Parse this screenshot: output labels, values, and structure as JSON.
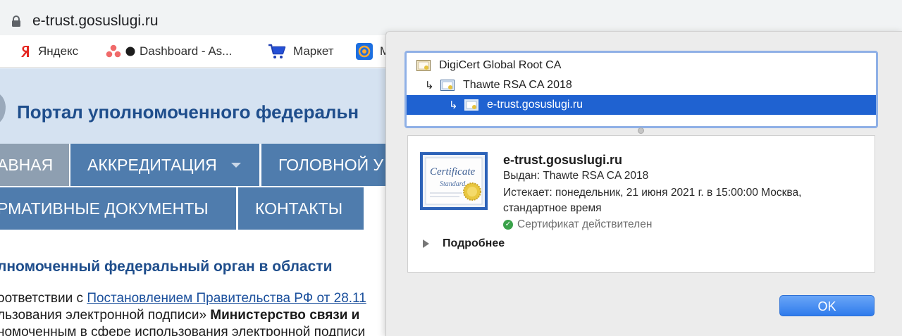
{
  "browser": {
    "url": "e-trust.gosuslugi.ru",
    "bookmarks": [
      {
        "label": "Яндекс",
        "icon": "yandex-icon"
      },
      {
        "label": "Dashboard - As...",
        "icon": "asana-icon"
      },
      {
        "label": "Маркет",
        "icon": "cart-icon"
      },
      {
        "label": "M",
        "icon": "mail-icon"
      }
    ]
  },
  "site": {
    "header_title": "Портал уполномоченного федеральн",
    "header_title_right": "н",
    "nav": [
      {
        "label": "АВНАЯ"
      },
      {
        "label": "АККРЕДИТАЦИЯ"
      },
      {
        "label": "ГОЛОВНОЙ У"
      },
      {
        "label": "РМАТИВНЫЕ ДОКУМЕНТЫ"
      },
      {
        "label": "КОНТАКТЫ"
      }
    ],
    "content_heading": "лномоченный федеральный орган в области",
    "para1_prefix": "оответствии с ",
    "para1_link": "Постановлением Правительства РФ от 28.11",
    "para2_text": "льзования электронной подписи» ",
    "para2_bold": "Министерство связи и",
    "para3_text": "номоченным в сфере использования электронной подписи",
    "right_hint1": "с",
    "right_hint2": "и"
  },
  "certificate": {
    "chain": [
      {
        "label": "DigiCert Global Root CA"
      },
      {
        "label": "Thawte RSA CA 2018",
        "arrow": "↳"
      },
      {
        "label": "e-trust.gosuslugi.ru",
        "arrow": "↳"
      }
    ],
    "name": "e-trust.gosuslugi.ru",
    "issued_by": "Выдан: Thawte RSA CA 2018",
    "expires_line1": "Истекает: понедельник, 21 июня 2021 г. в 15:00:00 Москва,",
    "expires_line2": "стандартное время",
    "status": "Сертификат действителен",
    "details_label": "Подробнее",
    "ok_label": "OK",
    "cert_art_text1": "Certificate",
    "cert_art_text2": "Standard"
  },
  "colors": {
    "selection": "#1f62d1",
    "nav_bg": "#4f7cad",
    "nav_active": "#8e9fb1",
    "header_bg": "#d5e2f1",
    "title": "#1f4e8c",
    "status_ok": "#3aa24a"
  }
}
